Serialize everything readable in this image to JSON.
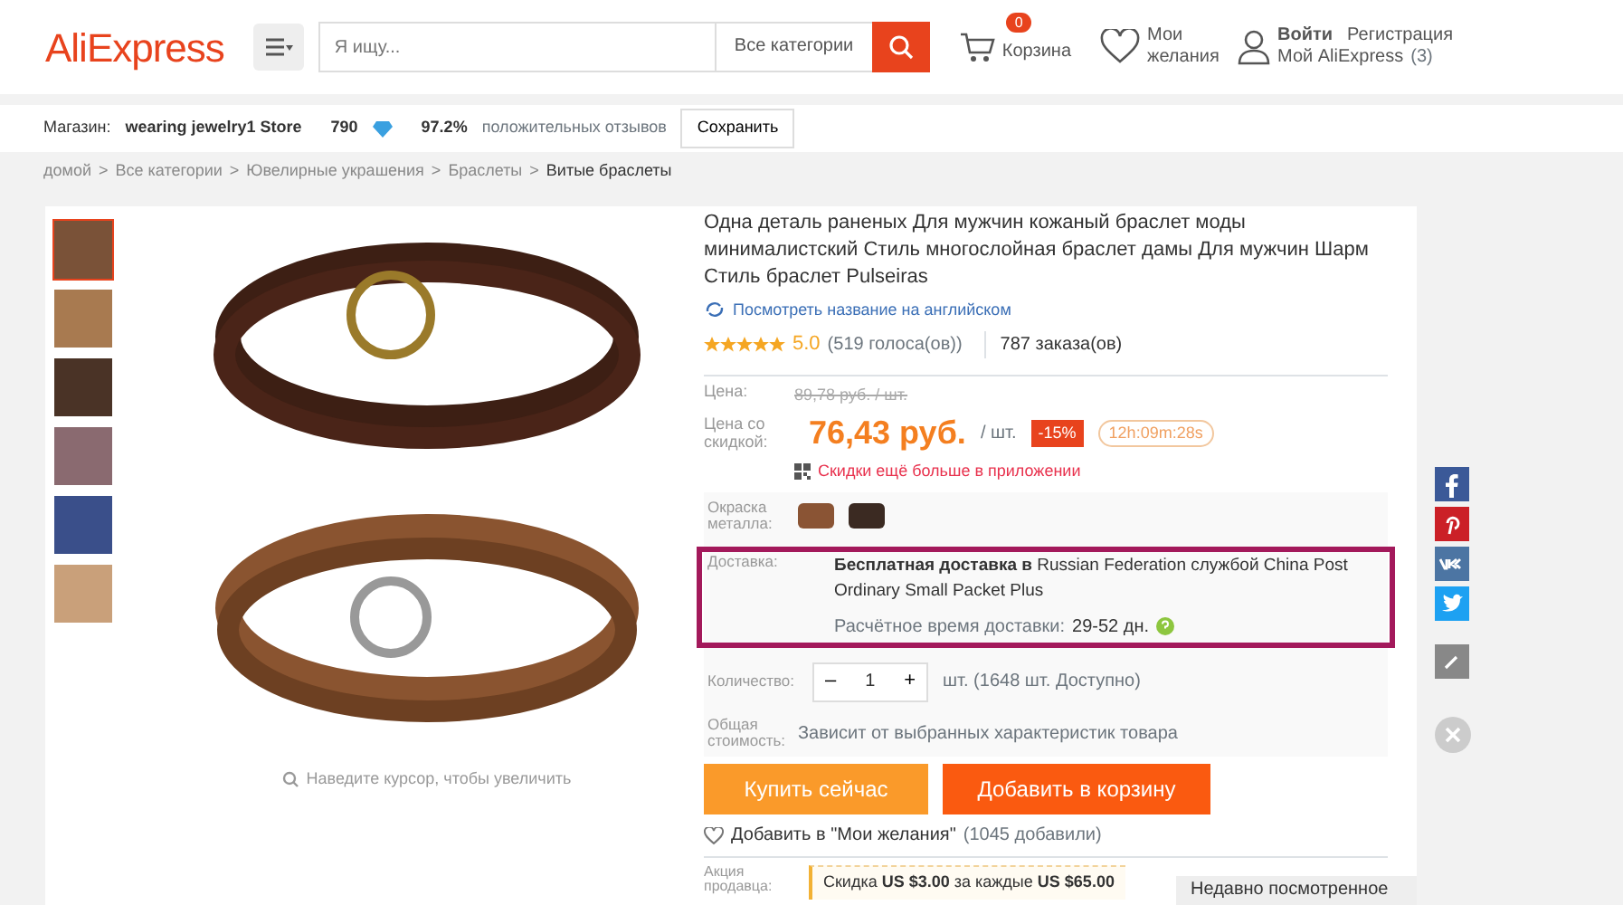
{
  "header": {
    "logo": "AliExpress",
    "search": {
      "placeholder": "Я ищу...",
      "category": "Все категории"
    },
    "cart": {
      "count": "0",
      "label": "Корзина"
    },
    "wishlist": {
      "label": "Мои желания"
    },
    "account": {
      "login": "Войти",
      "register": "Регистрация",
      "my": "Мой AliExpress",
      "my_count": "(3)"
    }
  },
  "store_bar": {
    "label": "Магазин:",
    "name": "wearing jewelry1 Store",
    "score": "790",
    "rating": "97.2%",
    "feedback": "положительных отзывов",
    "save": "Сохранить"
  },
  "breadcrumb": {
    "separator": ">",
    "items": [
      {
        "label": "домой",
        "selected": false
      },
      {
        "label": "Все категории",
        "selected": false
      },
      {
        "label": "Ювелирные украшения",
        "selected": false
      },
      {
        "label": "Браслеты",
        "selected": false
      },
      {
        "label": "Витые браслеты",
        "selected": true
      }
    ]
  },
  "gallery": {
    "thumbnails": [
      {
        "selected": true
      },
      {
        "selected": false
      },
      {
        "selected": false
      },
      {
        "selected": false
      },
      {
        "selected": false
      },
      {
        "selected": false
      }
    ],
    "zoom_hint": "Наведите курсор, чтобы увеличить"
  },
  "product": {
    "title": "Одна деталь раненых Для мужчин кожаный браслет моды минималистский Стиль многослойная браслет дамы Для мужчин Шарм Стиль браслет Pulseiras",
    "translate_link": "Посмотреть название на английском",
    "stars": 5,
    "rating": "5.0",
    "votes": "(519 голоса(ов))",
    "orders": "787 заказа(ов)"
  },
  "price": {
    "old_label": "Цена:",
    "old_price": "89,78 руб. / шт.",
    "label": "Цена со скидкой:",
    "price": "76,43 руб.",
    "unit": "/ шт.",
    "discount": "-15%",
    "timer": "12h:09m:28s",
    "app_promo": "Скидки ещё больше в приложении"
  },
  "options": {
    "color_label": "Окраска металла:",
    "swatches": [
      {
        "color": "#8a5434"
      },
      {
        "color": "#3b2a22"
      }
    ],
    "shipping": {
      "highlighted": true,
      "label": "Доставка:",
      "text": "**Бесплатная доставка в** Russian Federation службой China Post Ordinary Small Packet Plus",
      "time_label": "Расчётное время доставки:",
      "time": "29-52 дн."
    },
    "quantity": {
      "label": "Количество:",
      "minus": "–",
      "value": "1",
      "plus": "+",
      "stock": "шт. (1648 шт. Доступно)"
    },
    "total": {
      "label": "Общая стоимость:",
      "text": "Зависит от выбранных характеристик товара"
    }
  },
  "actions": {
    "buy": "Купить сейчас",
    "add_to_cart": "Добавить в корзину",
    "wishlist": "Добавить в \"Мои желания\"",
    "wishlist_count": "(1045 добавили)"
  },
  "promo": {
    "label": "Акция продавца:",
    "text": "Скидка **US $3.00** за каждые **US $65.00**"
  },
  "recently_viewed": "Недавно посмотренное"
}
